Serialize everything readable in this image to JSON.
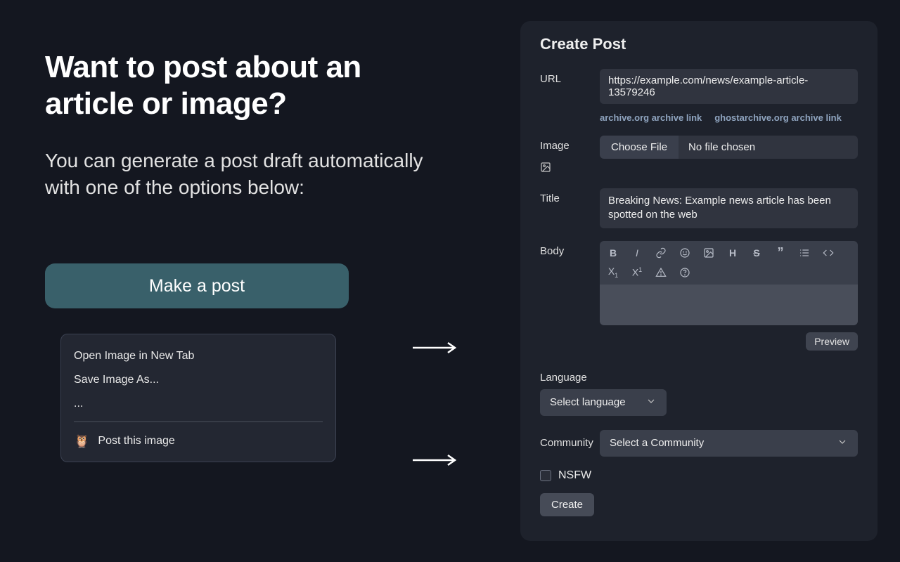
{
  "left": {
    "headline": "Want to post about an article or image?",
    "subhead": "You can generate a post draft automatically with one of the options below:",
    "make_post_btn": "Make a post",
    "ctx": {
      "open_image": "Open Image in New Tab",
      "save_as": "Save Image As...",
      "ellipsis": "...",
      "post_image": "Post this image",
      "owl": "🦉"
    }
  },
  "panel": {
    "title": "Create Post",
    "url_label": "URL",
    "url_value": "https://example.com/news/example-article-13579246",
    "archive_org": "archive.org archive link",
    "ghostarchive": "ghostarchive.org archive link",
    "image_label": "Image",
    "choose_file": "Choose File",
    "no_file": "No file chosen",
    "title_label": "Title",
    "title_value": "Breaking News: Example news article has been spotted on the web",
    "body_label": "Body",
    "preview": "Preview",
    "lang_label": "Language",
    "lang_select": "Select language",
    "community_label": "Community",
    "community_select": "Select a Community",
    "nsfw": "NSFW",
    "create": "Create"
  }
}
